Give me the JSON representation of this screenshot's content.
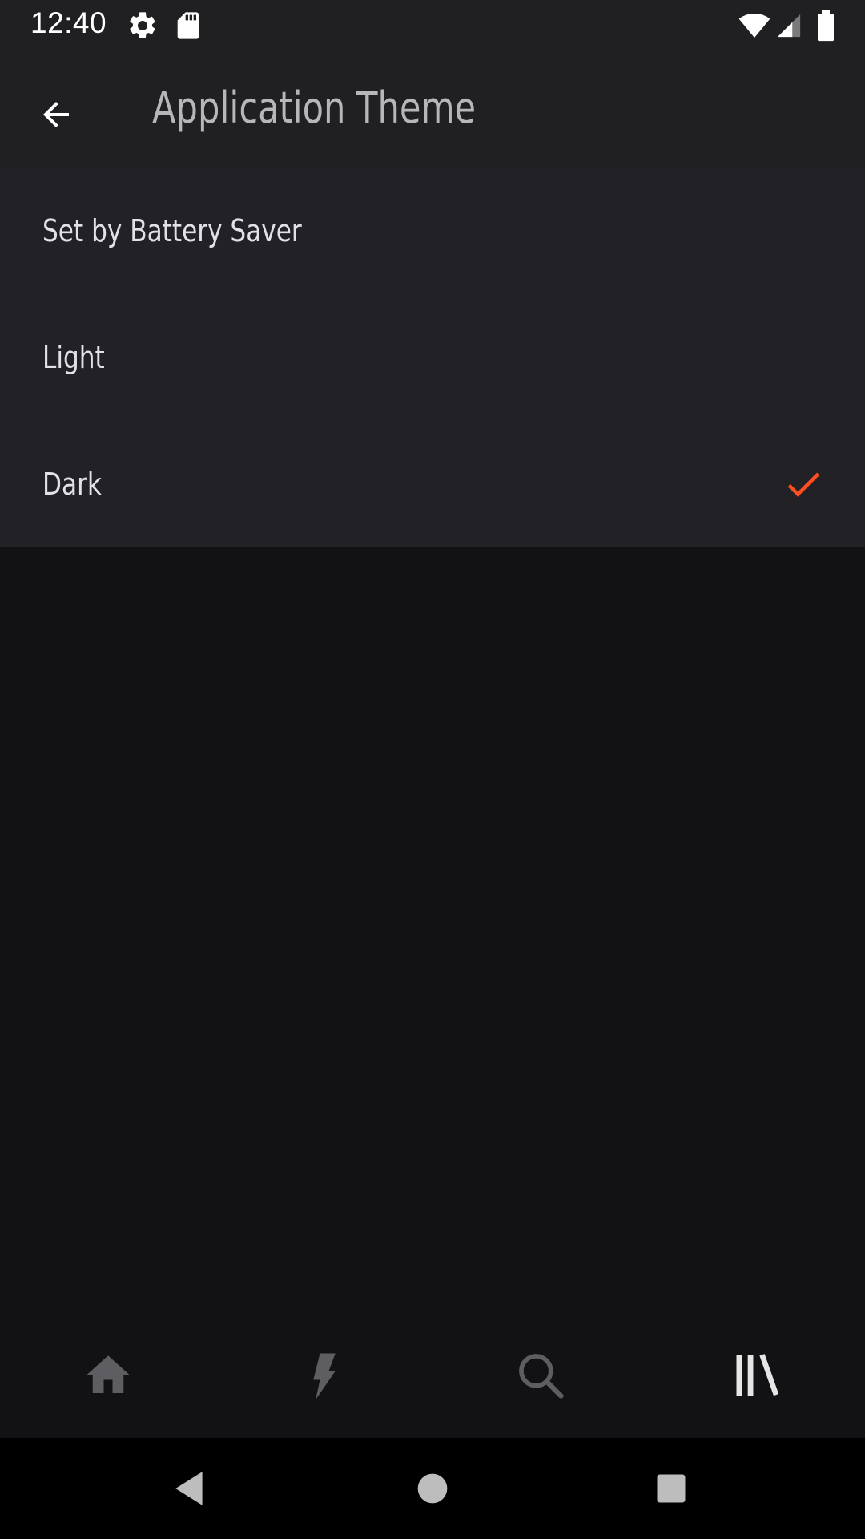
{
  "status_bar": {
    "time": "12:40",
    "left_icons": [
      "gear-icon",
      "sd-card-icon"
    ],
    "right_icons": [
      "wifi-icon",
      "signal-icon",
      "battery-icon"
    ]
  },
  "app_bar": {
    "back_icon": "arrow-left-icon",
    "title": "Application Theme"
  },
  "theme_options": [
    {
      "label": "Set by Battery Saver",
      "selected": false
    },
    {
      "label": "Light",
      "selected": false
    },
    {
      "label": "Dark",
      "selected": true
    }
  ],
  "bottom_nav": {
    "items": [
      {
        "icon": "home-icon",
        "active": false
      },
      {
        "icon": "lightning-icon",
        "active": false
      },
      {
        "icon": "search-icon",
        "active": false
      },
      {
        "icon": "library-icon",
        "active": true
      }
    ]
  },
  "system_nav": {
    "items": [
      "back-triangle-icon",
      "home-circle-icon",
      "recents-square-icon"
    ]
  },
  "colors": {
    "background": "#121214",
    "surface": "#222226",
    "app_bar": "#202023",
    "accent": "#FF4F1F",
    "text_primary": "#E2E2E6",
    "title_text": "#B7B7BB",
    "nav_inactive": "#5E5E62",
    "nav_active": "#E6E6E6"
  }
}
